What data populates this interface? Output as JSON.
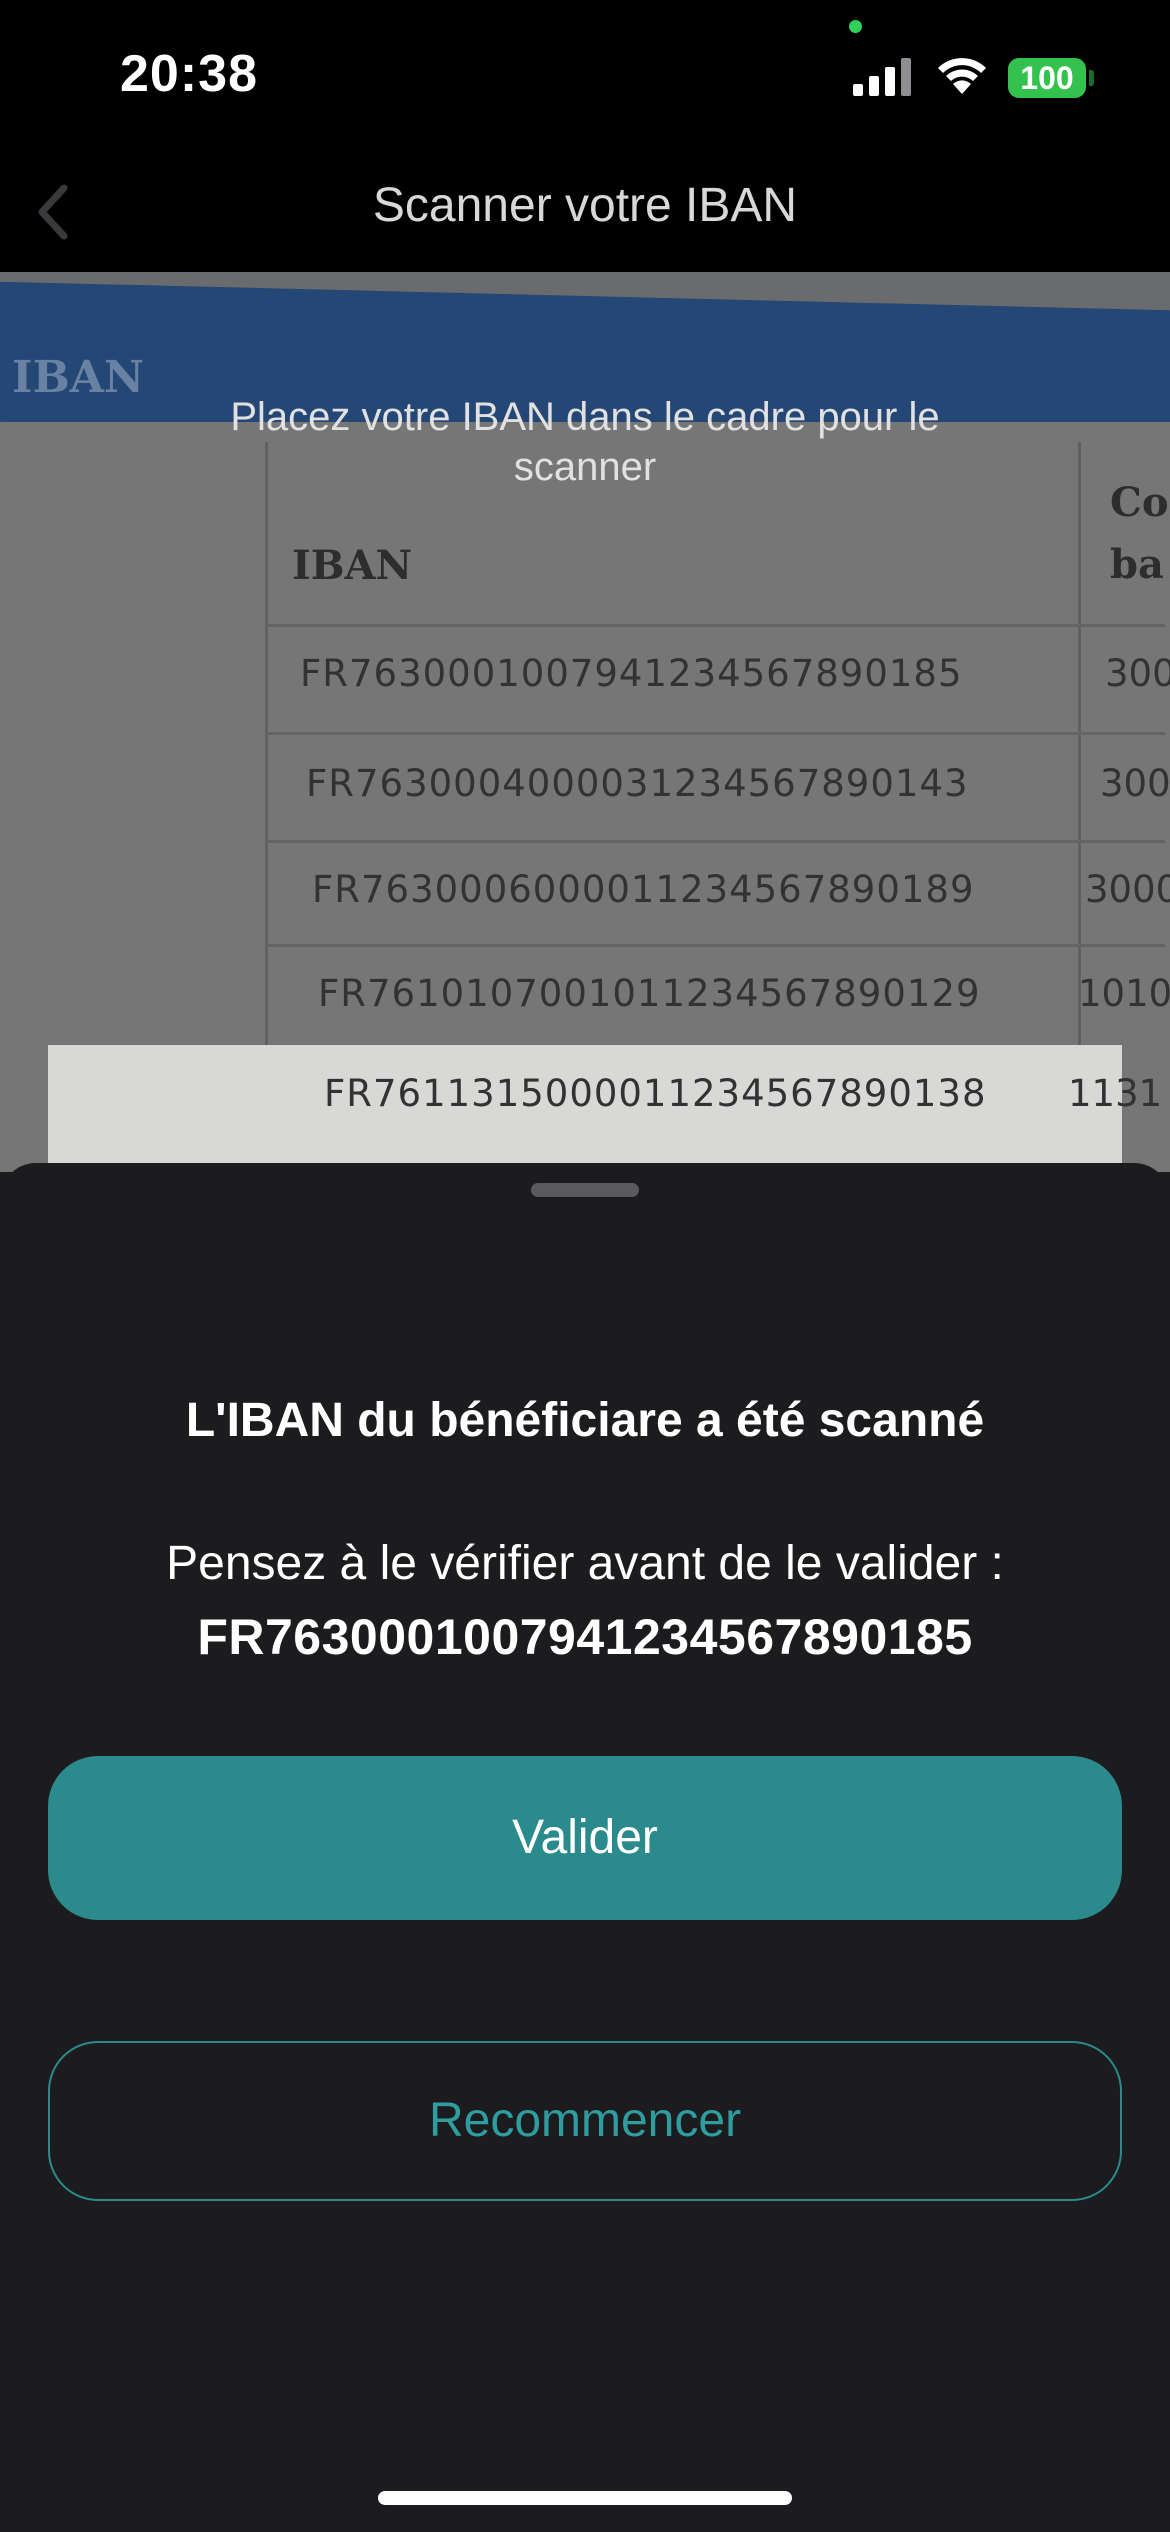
{
  "status_bar": {
    "time": "20:38",
    "battery": "100",
    "icons": [
      "signal-icon",
      "wifi-icon",
      "battery-icon"
    ],
    "battery_color": "#32c24d"
  },
  "nav": {
    "title": "Scanner votre IBAN",
    "back_icon": "chevron-left-icon"
  },
  "camera": {
    "hint": "Placez votre IBAN dans le cadre pour le scanner",
    "document": {
      "banner_label": "IBAN",
      "column_header": "IBAN",
      "second_column_header": "Co ba",
      "rows": [
        {
          "iban": "FR7630001007941234567890185",
          "code": "300"
        },
        {
          "iban": "FR7630004000031234567890143",
          "code": "300"
        },
        {
          "iban": "FR7630006000011234567890189",
          "code": "3000"
        },
        {
          "iban": "FR7610107001011234567890129",
          "code": "1010"
        },
        {
          "iban": "FR7611315000011234567890138",
          "code": "1131"
        }
      ]
    }
  },
  "sheet": {
    "title": "L'IBAN du bénéficiare a été scanné",
    "message": "Pensez à le vérifier avant de le valider :",
    "iban": "FR7630001007941234567890185",
    "primary_button": "Valider",
    "secondary_button": "Recommencer",
    "accent_color": "#2b8a8c"
  }
}
